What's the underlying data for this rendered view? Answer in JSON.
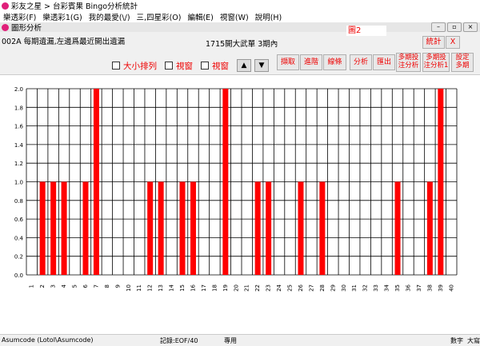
{
  "app": {
    "title": "彩友之星 > 台彩賓果 Bingo分析統計"
  },
  "menu": [
    "樂透彩(F)",
    "樂透彩1(G)",
    "我的最愛(\\/)",
    "三,四星彩(O)",
    "編輯(E)",
    "視窗(W)",
    "說明(H)"
  ],
  "inner": {
    "title": "圖形分析",
    "figure_label": "圖2",
    "description": "002A 每期遺漏,左邊爲最近開出遺漏",
    "center_title": "1715開大武單 3期內",
    "stat_button": "統計",
    "close_button": "X"
  },
  "options": {
    "sort_label": "大小排列",
    "view1_label": "視窗",
    "view2_label": "視窗"
  },
  "toolbar": {
    "extract": "擷取",
    "advanced": "進階",
    "line": "線條",
    "analyze": "分析",
    "export": "匯出",
    "multi1": [
      "多期投",
      "注分析"
    ],
    "multi2": [
      "多期投",
      "注分析1"
    ],
    "setmulti": [
      "設定",
      "多期"
    ]
  },
  "status": {
    "left": "Asumcode (Lotol\\Asumcode)",
    "record": "記錄:EOF/40",
    "mode": "專用",
    "numlock": "數字",
    "caps": "大寫"
  },
  "colors": {
    "bar": "#ff0000",
    "grid": "#000000"
  },
  "chart_data": {
    "type": "bar",
    "categories": [
      "1",
      "2",
      "3",
      "4",
      "5",
      "6",
      "7",
      "8",
      "9",
      "10",
      "11",
      "12",
      "13",
      "14",
      "15",
      "16",
      "17",
      "18",
      "19",
      "20",
      "21",
      "22",
      "23",
      "24",
      "25",
      "26",
      "27",
      "28",
      "29",
      "30",
      "31",
      "32",
      "33",
      "34",
      "35",
      "36",
      "37",
      "38",
      "39",
      "40"
    ],
    "values": [
      0,
      1,
      1,
      1,
      0,
      1,
      2,
      0,
      0,
      0,
      0,
      1,
      1,
      0,
      1,
      1,
      0,
      0,
      2,
      0,
      0,
      1,
      1,
      0,
      0,
      1,
      0,
      1,
      0,
      0,
      0,
      0,
      0,
      0,
      1,
      0,
      0,
      1,
      2,
      0
    ],
    "ylim": [
      0,
      2.0
    ],
    "yticks": [
      "0.0",
      "0.2",
      "0.4",
      "0.6",
      "0.8",
      "1.0",
      "1.2",
      "1.4",
      "1.6",
      "1.8",
      "2.0"
    ]
  }
}
